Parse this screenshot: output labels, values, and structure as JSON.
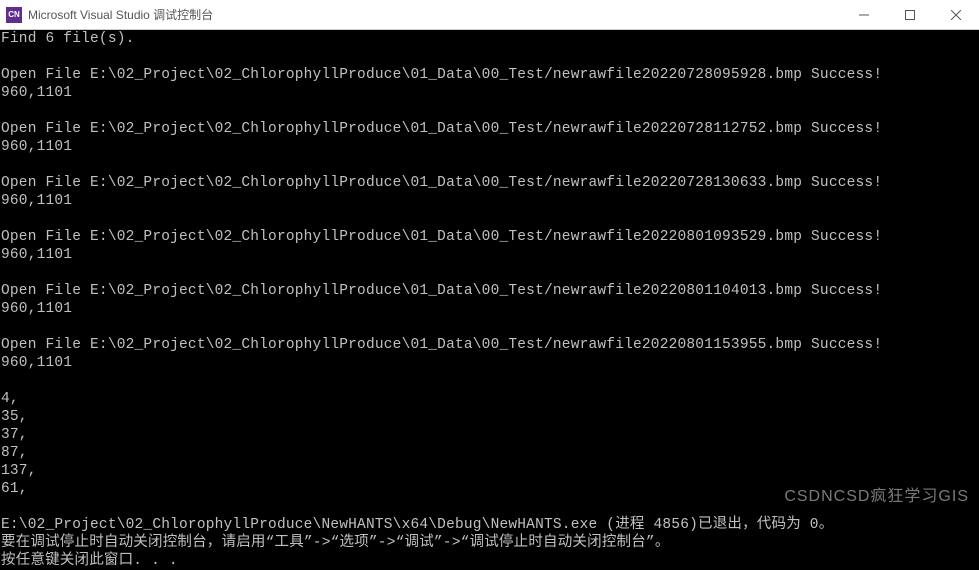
{
  "window": {
    "title": "Microsoft Visual Studio 调试控制台",
    "icon_abbr": "CN"
  },
  "console": {
    "header": "Find 6 file(s).",
    "entries": [
      {
        "path": "E:\\02_Project\\02_ChlorophyllProduce\\01_Data\\00_Test/newrawfile20220728095928.bmp",
        "status": "Success!",
        "dims": "960,1101"
      },
      {
        "path": "E:\\02_Project\\02_ChlorophyllProduce\\01_Data\\00_Test/newrawfile20220728112752.bmp",
        "status": "Success!",
        "dims": "960,1101"
      },
      {
        "path": "E:\\02_Project\\02_ChlorophyllProduce\\01_Data\\00_Test/newrawfile20220728130633.bmp",
        "status": "Success!",
        "dims": "960,1101"
      },
      {
        "path": "E:\\02_Project\\02_ChlorophyllProduce\\01_Data\\00_Test/newrawfile20220801093529.bmp",
        "status": "Success!",
        "dims": "960,1101"
      },
      {
        "path": "E:\\02_Project\\02_ChlorophyllProduce\\01_Data\\00_Test/newrawfile20220801104013.bmp",
        "status": "Success!",
        "dims": "960,1101"
      },
      {
        "path": "E:\\02_Project\\02_ChlorophyllProduce\\01_Data\\00_Test/newrawfile20220801153955.bmp",
        "status": "Success!",
        "dims": "960,1101"
      }
    ],
    "numbers": [
      "4,",
      "35,",
      "37,",
      "87,",
      "137,",
      "61,"
    ],
    "exit_line": "E:\\02_Project\\02_ChlorophyllProduce\\NewHANTS\\x64\\Debug\\NewHANTS.exe (进程 4856)已退出，代码为 0。",
    "hint_line": "要在调试停止时自动关闭控制台，请启用“工具”->“选项”->“调试”->“调试停止时自动关闭控制台”。",
    "press_key_line": "按任意键关闭此窗口. . ."
  },
  "watermark": "CSDNCSD疯狂学习GIS"
}
